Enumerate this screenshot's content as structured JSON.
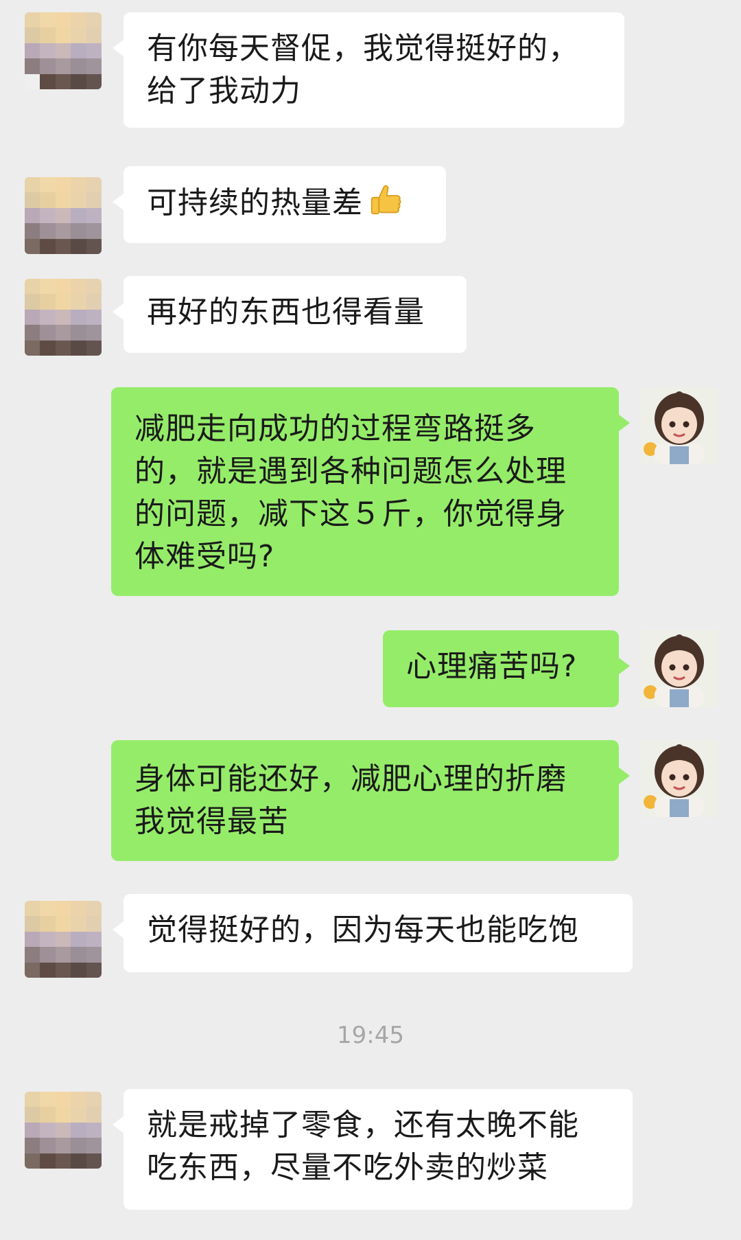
{
  "messages": [
    {
      "side": "in",
      "text": "有你每天督促，我觉得挺好的，给了我动力"
    },
    {
      "side": "in",
      "text": "可持续的热量差",
      "icon": "thumbs-up-icon"
    },
    {
      "side": "in",
      "text": "再好的东西也得看量"
    },
    {
      "side": "out",
      "text": "减肥走向成功的过程弯路挺多的，就是遇到各种问题怎么处理的问题，减下这５斤，你觉得身体难受吗?"
    },
    {
      "side": "out",
      "text": "心理痛苦吗?"
    },
    {
      "side": "out",
      "text": "身体可能还好，减肥心理的折磨我觉得最苦"
    },
    {
      "side": "in",
      "text": "觉得挺好的，因为每天也能吃饱"
    },
    {
      "side": "in",
      "text": "就是戒掉了零食，还有太晚不能吃东西，尽量不吃外卖的炒菜"
    }
  ],
  "timestamp": "19:45",
  "colors": {
    "background": "#ededed",
    "incoming_bubble": "#ffffff",
    "outgoing_bubble": "#95ec69",
    "timestamp_text": "#a6a6a6"
  },
  "avatars": {
    "contact": "pixelated-avatar-icon",
    "self": "cartoon-girl-avatar-icon"
  }
}
